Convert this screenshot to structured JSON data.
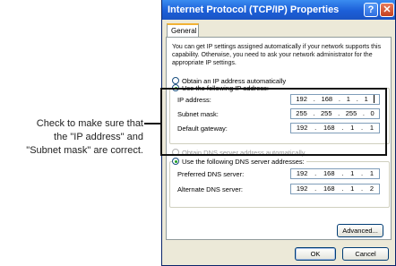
{
  "callout": {
    "line1": "Check to make sure that",
    "line2": "the \"IP address\" and",
    "line3": "\"Subnet mask\" are correct."
  },
  "window": {
    "title": "Internet Protocol (TCP/IP) Properties",
    "help_glyph": "?",
    "close_glyph": "✕",
    "tab": "General",
    "intro": "You can get IP settings assigned automatically if your network supports this capability. Otherwise, you need to ask your network administrator for the appropriate IP settings."
  },
  "ip_mode": {
    "auto_label": "Obtain an IP address automatically",
    "manual_label": "Use the following IP address:",
    "selected": "manual"
  },
  "ip_fields": {
    "ip_address": {
      "label": "IP address:",
      "octets": [
        "192",
        "168",
        "1",
        "1"
      ]
    },
    "subnet_mask": {
      "label": "Subnet mask:",
      "octets": [
        "255",
        "255",
        "255",
        "0"
      ]
    },
    "default_gateway": {
      "label": "Default gateway:",
      "octets": [
        "192",
        "168",
        "1",
        "1"
      ]
    }
  },
  "dns_mode": {
    "auto_label": "Obtain DNS server address automatically",
    "manual_label": "Use the following DNS server addresses:",
    "selected": "manual"
  },
  "dns_fields": {
    "preferred": {
      "label": "Preferred DNS server:",
      "octets": [
        "192",
        "168",
        "1",
        "1"
      ]
    },
    "alternate": {
      "label": "Alternate DNS server:",
      "octets": [
        "192",
        "168",
        "1",
        "2"
      ]
    }
  },
  "buttons": {
    "advanced": "Advanced...",
    "ok": "OK",
    "cancel": "Cancel"
  },
  "icons": {
    "help": "help-icon",
    "close": "close-icon"
  },
  "colors": {
    "titlebar": "#1c5fd8",
    "radio_dot": "#21a121",
    "highlight_border": "#111111"
  }
}
